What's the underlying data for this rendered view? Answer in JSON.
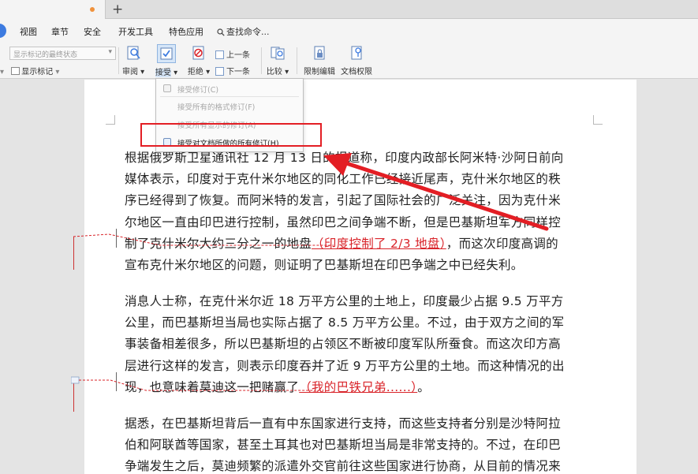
{
  "menu": {
    "items": [
      "视图",
      "章节",
      "安全",
      "开发工具",
      "特色应用"
    ],
    "search_label": "查找命令..."
  },
  "ribbon": {
    "status_placeholder": "显示标记的最终状态",
    "show_markup": "显示标记",
    "review": "审阅",
    "accept": "接受",
    "reject": "拒绝",
    "prev": "上一条",
    "next": "下一条",
    "compare": "比较",
    "restrict_edit": "限制编辑",
    "doc_permission": "文档权限"
  },
  "dropdown": {
    "items": [
      {
        "label": "接受修订(C)",
        "enabled": false
      },
      {
        "label": "接受所有的格式修订(F)",
        "enabled": false
      },
      {
        "label": "接受所有显示的修订(A)",
        "enabled": false
      },
      {
        "label": "接受对文档所做的所有修订(H)",
        "enabled": true
      }
    ]
  },
  "document": {
    "para1_lines": [
      "根据俄罗斯卫星通讯社 12 月 13 日的报道称，印度内政部长阿米特·沙阿日前向",
      "媒体表示，印度对于克什米尔地区的同化工作已经接近尾声，克什米尔地区的秩",
      "序已经得到了恢复。而阿米特的发言，引起了国际社会的广泛关注，因为克什米",
      "尔地区一直由印巴进行控制，虽然印巴之间争端不断，但是巴基斯坦军方同样控"
    ],
    "para1_l5_a": "制了克什米尔大约三分之一的地盘",
    "para1_l5_ins": "（印度控制了 2/3 地盘）",
    "para1_l5_b": "，而这次印度高调的",
    "para1_l6": "宣布克什米尔地区的问题，则证明了巴基斯坦在印巴争端之中已经失利。",
    "para2_lines": [
      "消息人士称，在克什米尔近 18 万平方公里的土地上，印度最少占据 9.5 万平方",
      "公里，而巴基斯坦当局也实际占据了 8.5 万平方公里。不过，由于双方之间的军",
      "事装备相差很多，所以巴基斯坦的占领区不断被印度军队所蚕食。而这次印方高",
      "层进行这样的发言，则表示印度吞并了近 9 万平方公里的土地。而这种情况的出"
    ],
    "para2_l5_a": "现，也意味着莫迪这一把赌赢了",
    "para2_l5_ins": "（我的巴铁兄弟......）",
    "para2_l5_b": "。",
    "para3_lines": [
      "据悉，在巴基斯坦背后一直有中东国家进行支持，而这些支持者分别是沙特阿拉",
      "伯和阿联酋等国家，甚至土耳其也对巴基斯坦当局是非常支持的。不过，在印巴",
      "争端发生之后，莫迪频繁的派遣外交官前往这些国家进行协商，从目前的情况来"
    ]
  }
}
